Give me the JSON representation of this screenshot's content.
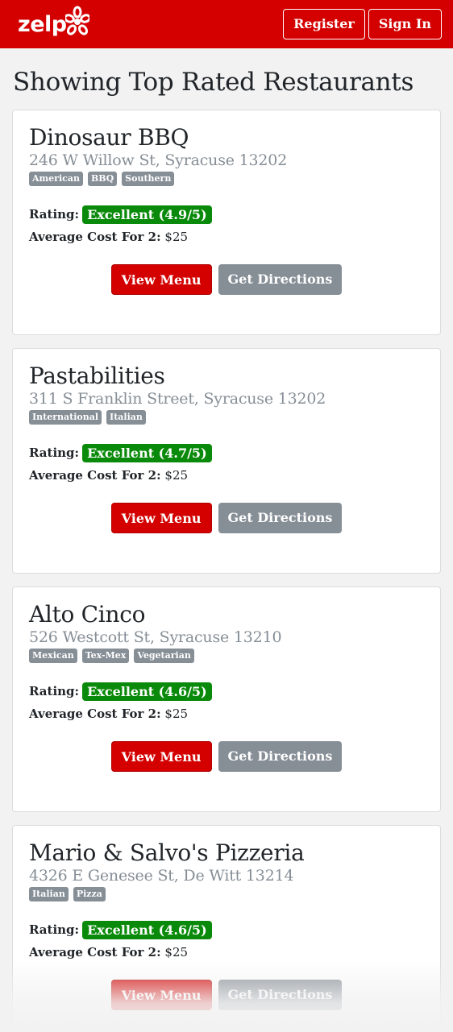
{
  "header": {
    "brand": "zelp",
    "register_label": "Register",
    "signin_label": "Sign In",
    "brand_color": "#d40000"
  },
  "page": {
    "title": "Showing Top Rated Restaurants"
  },
  "labels": {
    "rating": "Rating:",
    "cost": "Average Cost For 2:",
    "view_menu": "View Menu",
    "get_directions": "Get Directions"
  },
  "restaurants": [
    {
      "name": "Dinosaur BBQ",
      "address": "246 W Willow St, Syracuse 13202",
      "tags": [
        "American",
        "BBQ",
        "Southern"
      ],
      "rating": "Excellent (4.9/5)",
      "cost": "$25"
    },
    {
      "name": "Pastabilities",
      "address": "311 S Franklin Street, Syracuse 13202",
      "tags": [
        "International",
        "Italian"
      ],
      "rating": "Excellent (4.7/5)",
      "cost": "$25"
    },
    {
      "name": "Alto Cinco",
      "address": "526 Westcott St, Syracuse 13210",
      "tags": [
        "Mexican",
        "Tex-Mex",
        "Vegetarian"
      ],
      "rating": "Excellent (4.6/5)",
      "cost": "$25"
    },
    {
      "name": "Mario & Salvo's Pizzeria",
      "address": "4326 E Genesee St, De Witt 13214",
      "tags": [
        "Italian",
        "Pizza"
      ],
      "rating": "Excellent (4.6/5)",
      "cost": "$25"
    }
  ],
  "colors": {
    "rating_badge": "#0a8a0a",
    "tag": "#868e96",
    "secondary_button": "#868e96"
  }
}
